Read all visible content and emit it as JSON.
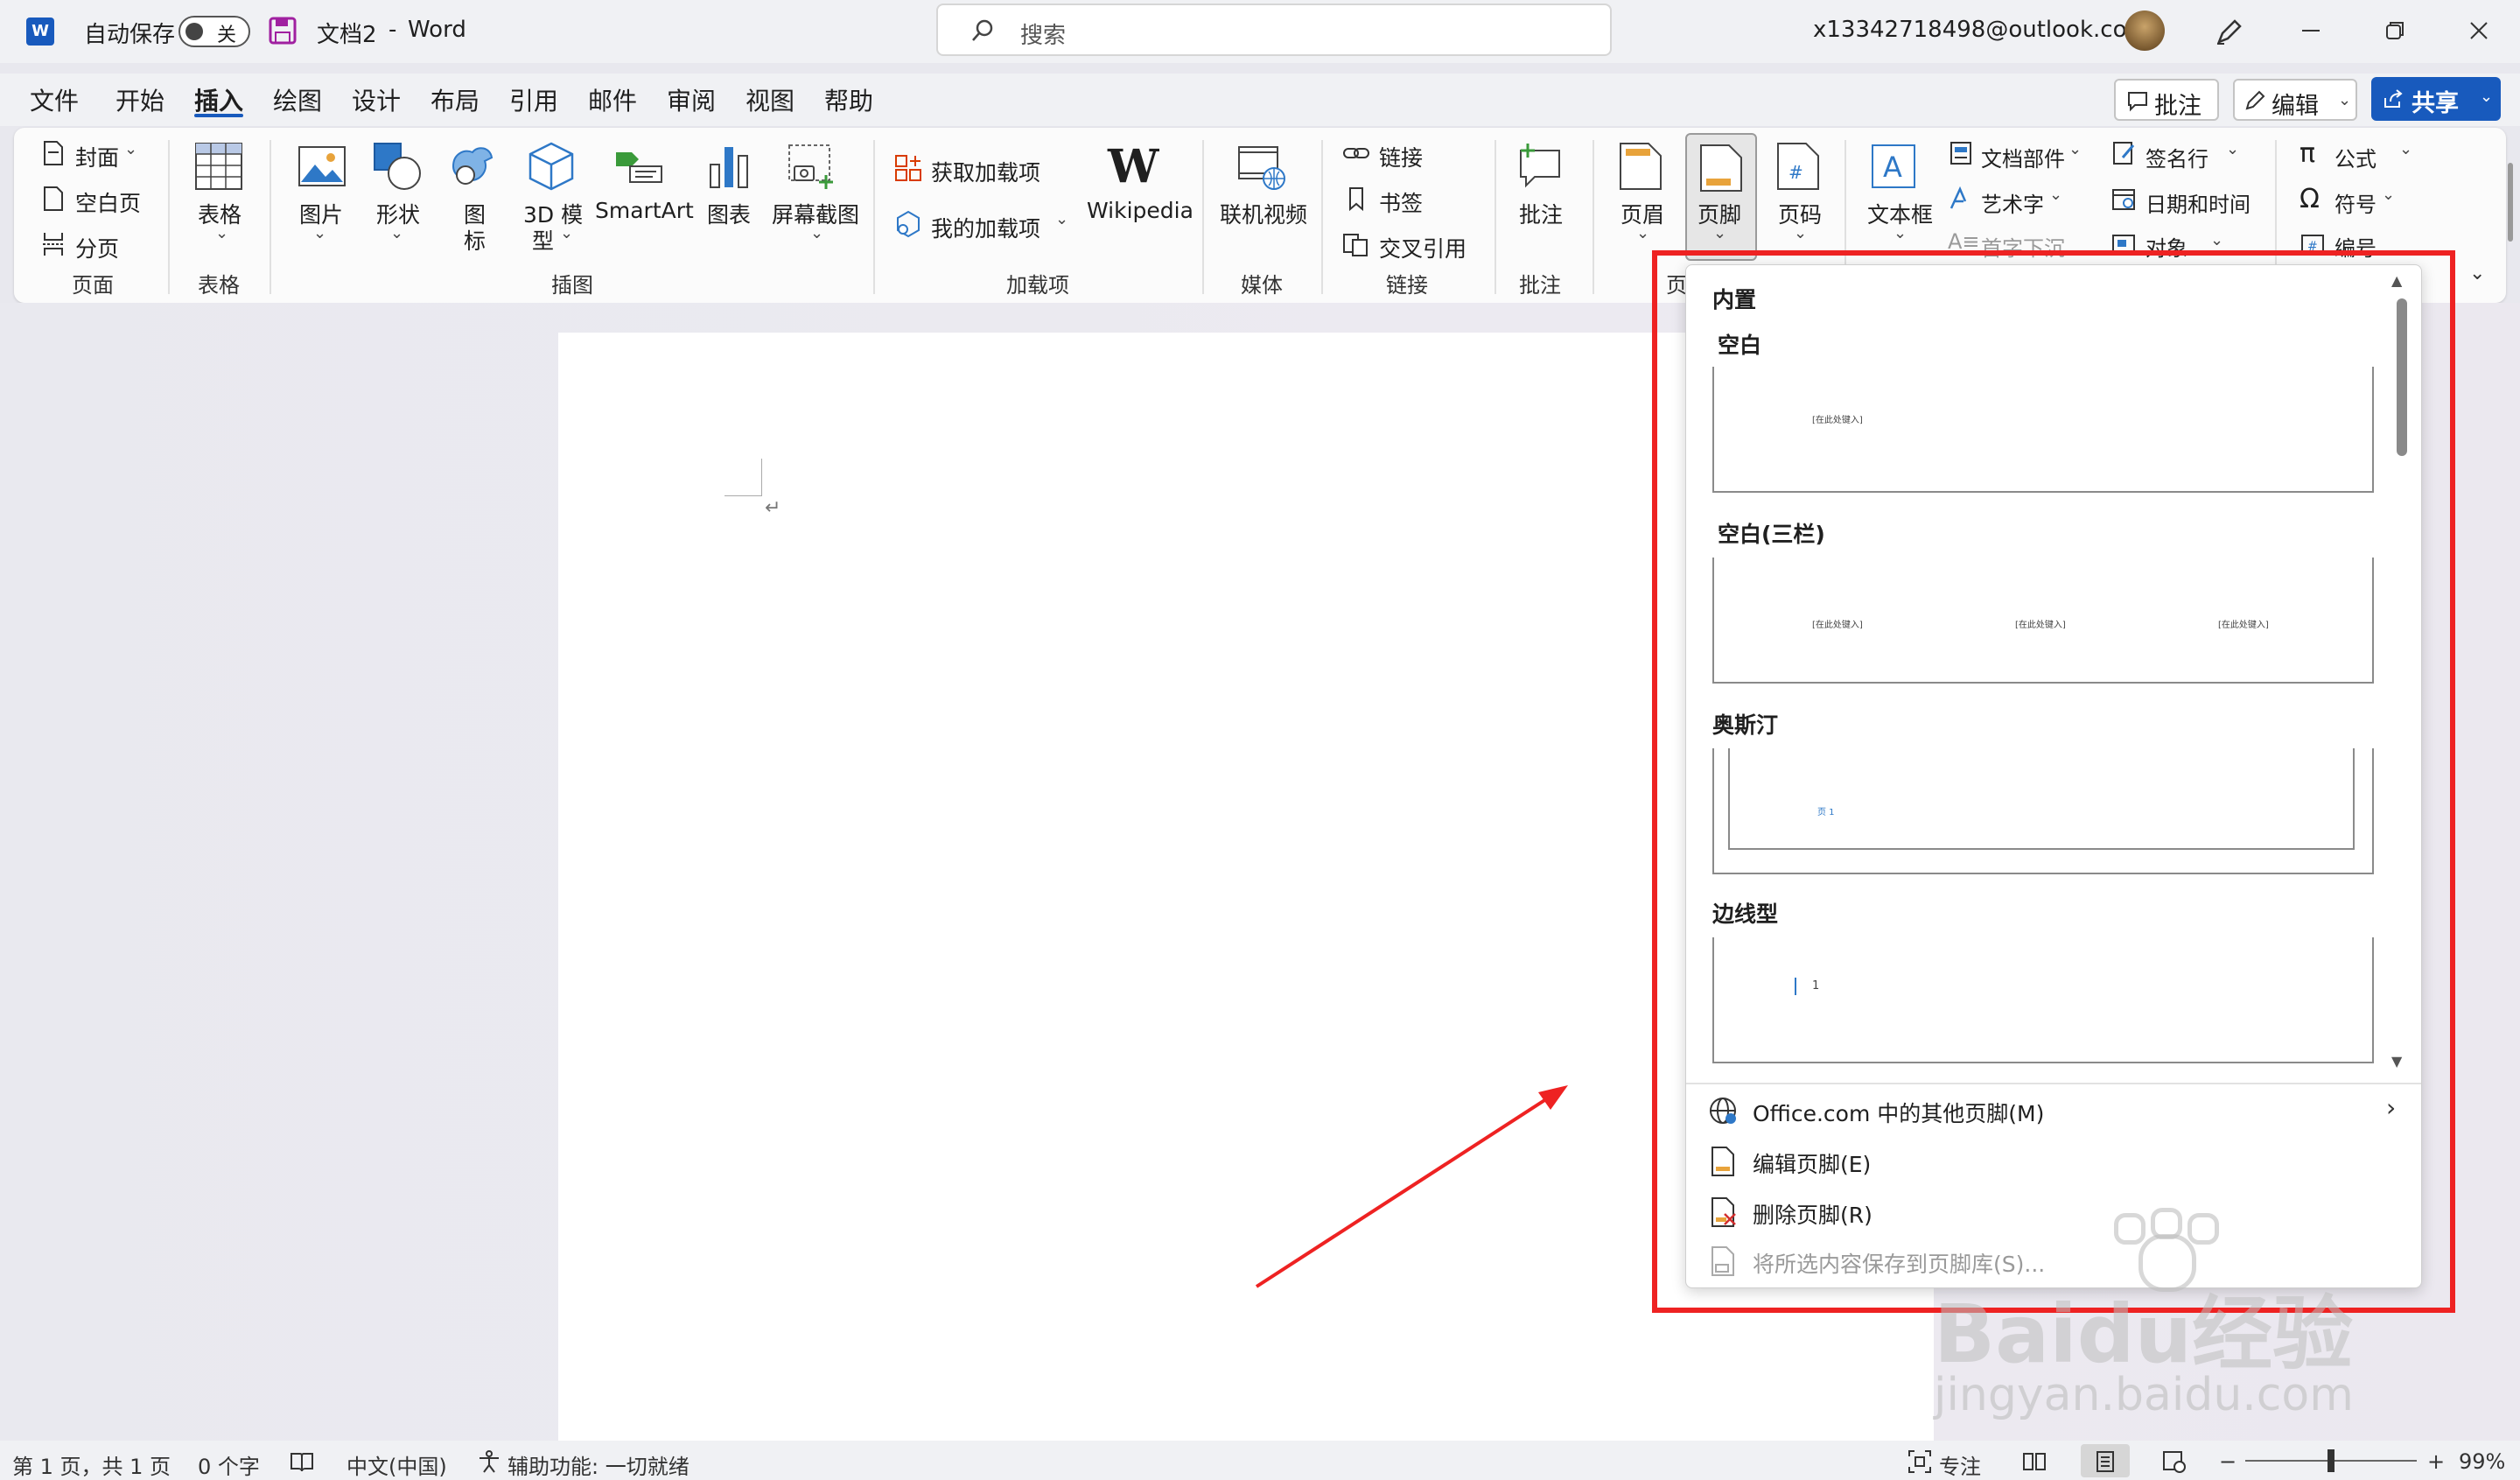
{
  "titlebar": {
    "autosave_label": "自动保存",
    "autosave_state": "关",
    "doc_title": "文档2",
    "sep": "-",
    "app_name": "Word",
    "search_placeholder": "搜索",
    "account": "x13342718498@outlook.com"
  },
  "menu": {
    "tabs": [
      "文件",
      "开始",
      "插入",
      "绘图",
      "设计",
      "布局",
      "引用",
      "邮件",
      "审阅",
      "视图",
      "帮助"
    ],
    "active_tab": "插入",
    "comments_btn": "批注",
    "edit_btn": "编辑",
    "share_btn": "共享"
  },
  "ribbon": {
    "pages": {
      "cover": "封面",
      "blank": "空白页",
      "break": "分页",
      "group": "页面"
    },
    "tables": {
      "table": "表格",
      "group": "表格"
    },
    "illustrations": {
      "picture": "图片",
      "shapes": "形状",
      "icons_1": "图",
      "icons_2": "标",
      "model_1": "3D 模",
      "model_2": "型",
      "smartart": "SmartArt",
      "chart": "图表",
      "screenshot": "屏幕截图",
      "group": "插图"
    },
    "addins": {
      "get": "获取加载项",
      "mine": "我的加载项",
      "wiki": "Wikipedia",
      "group": "加载项"
    },
    "media": {
      "video": "联机视频",
      "group": "媒体"
    },
    "links": {
      "link": "链接",
      "bookmark": "书签",
      "crossref": "交叉引用",
      "group": "链接"
    },
    "comments": {
      "comment": "批注",
      "group": "批注"
    },
    "header_footer": {
      "header": "页眉",
      "footer": "页脚",
      "page_number": "页码",
      "group_partial": "页"
    },
    "text": {
      "textbox": "文本框",
      "quickparts": "文档部件",
      "wordart": "艺术字",
      "dropcap": "首字下沉",
      "signature": "签名行",
      "datetime": "日期和时间",
      "object": "对象"
    },
    "symbols": {
      "equation": "公式",
      "symbol": "符号",
      "number": "编号"
    }
  },
  "dropdown": {
    "section": "内置",
    "items": [
      {
        "name": "空白",
        "placeholder": "[在此处键入]"
      },
      {
        "name": "空白(三栏)",
        "placeholder": "[在此处键入]"
      },
      {
        "name": "奥斯汀",
        "placeholder": "页 1"
      },
      {
        "name": "边线型",
        "placeholder": "1"
      }
    ],
    "more": "Office.com 中的其他页脚(M)",
    "edit": "编辑页脚(E)",
    "remove": "删除页脚(R)",
    "save": "将所选内容保存到页脚库(S)..."
  },
  "statusbar": {
    "page": "第 1 页，共 1 页",
    "words": "0 个字",
    "lang": "中文(中国)",
    "accessibility": "辅助功能: 一切就绪",
    "focus": "专注",
    "zoom": "99%",
    "zoom_minus": "−",
    "zoom_plus": "+"
  },
  "watermark": {
    "text": "Baidu经验",
    "sub": "jingyan.baidu.com"
  },
  "colors": {
    "accent": "#185abd",
    "highlight": "#ee2222",
    "word_blue": "#185abd"
  }
}
